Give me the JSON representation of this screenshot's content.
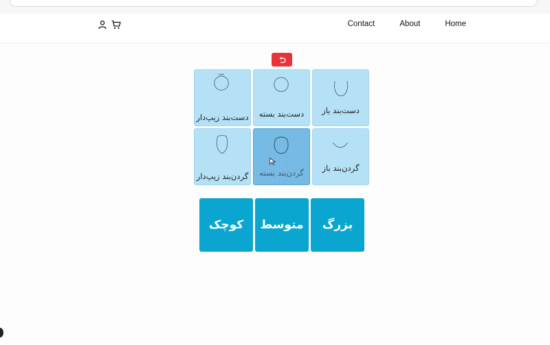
{
  "nav": {
    "links": [
      "Contact",
      "About",
      "Home"
    ],
    "icons": [
      "user-icon",
      "cart-icon"
    ]
  },
  "toolbar": {
    "undo_icon": "undo-icon",
    "undo_color": "#e8333a"
  },
  "grid": {
    "items": [
      {
        "label": "دست‌بند زیپ‌دار",
        "icon": "zipper-bracelet-icon",
        "selected": false
      },
      {
        "label": "دست‌بند بسته",
        "icon": "closed-bracelet-icon",
        "selected": false
      },
      {
        "label": "دست‌بند باز",
        "icon": "open-bracelet-icon",
        "selected": false
      },
      {
        "label": "گردن‌بند زیپ‌دار",
        "icon": "zipper-necklace-icon",
        "selected": false
      },
      {
        "label": "گردن‌بند بسته",
        "icon": "closed-necklace-icon",
        "selected": true
      },
      {
        "label": "گردن‌بند باز",
        "icon": "open-necklace-icon",
        "selected": false
      }
    ],
    "cell_color": "#b5e1f6",
    "selected_color": "#79bde6"
  },
  "sizes": {
    "options": [
      "کوچک",
      "متوسط",
      "بزرگ"
    ],
    "color": "#0aa6cf"
  }
}
